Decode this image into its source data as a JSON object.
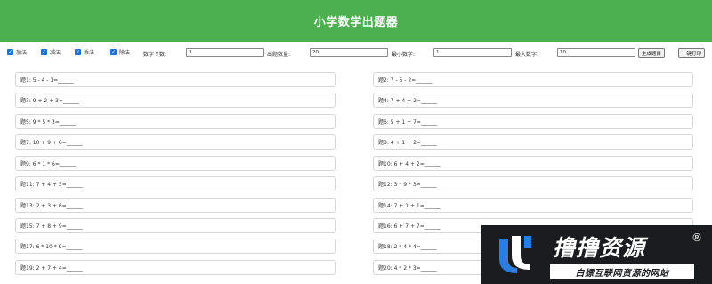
{
  "header": {
    "title": "小学数学出题器"
  },
  "controls": {
    "ops": [
      {
        "label": "加法",
        "checked": true
      },
      {
        "label": "减法",
        "checked": true
      },
      {
        "label": "乘法",
        "checked": true
      },
      {
        "label": "除法",
        "checked": true
      }
    ],
    "num_count_label": "数字个数:",
    "num_count_value": "3",
    "problem_count_label": "出题数量:",
    "problem_count_value": "20",
    "min_label": "最小数字:",
    "min_value": "1",
    "max_label": "最大数字:",
    "max_value": "10",
    "generate_label": "生成题目",
    "print_label": "一键打印"
  },
  "problems": [
    "题1: 5 - 4 - 1=______",
    "题2: 7 - 5 - 2=______",
    "题3: 9 + 2 + 3=______",
    "题4: 7 + 4 + 2=______",
    "题5: 9 * 5 * 3=______",
    "题6: 5 + 1 + 7=______",
    "题7: 10 + 9 + 6=______",
    "题8: 4 + 1 + 2=______",
    "题9: 6 * 1 * 6=______",
    "题10: 6 + 4 + 2=______",
    "题11: 7 + 4 + 5=______",
    "题12: 3 * 9 * 3=______",
    "题13: 2 + 3 + 6=______",
    "题14: 7 + 1 + 1=______",
    "题15: 7 + 8 + 9=______",
    "题16: 6 + 7 + 7=______",
    "题17: 6 * 10 * 9=______",
    "题18: 2 * 4 * 4=______",
    "题19: 2 + 7 + 4=______",
    "题20: 4 * 2 * 3=______"
  ],
  "watermark": {
    "title": "撸撸资源",
    "reg": "®",
    "subtitle": "白嫖互联网资源的网站",
    "logo_icon": "jl-logo-icon",
    "bg_color": "#1b1c1f",
    "accent": "#2a7de1"
  }
}
